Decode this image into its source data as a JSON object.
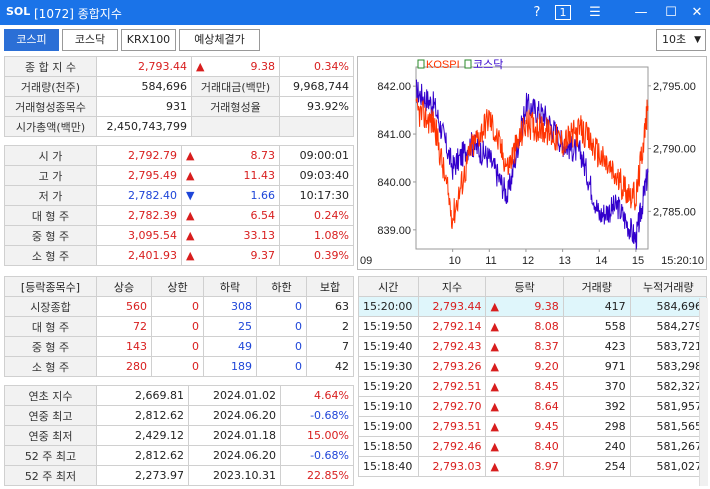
{
  "window": {
    "logo": "SOL",
    "title": "[1072] 종합지수",
    "help": "?",
    "page_num": "1",
    "menu": "☰",
    "minimize": "—",
    "maximize": "☐",
    "close": "✕"
  },
  "tabs": [
    "코스피",
    "코스닥",
    "KRX100",
    "예상체결가"
  ],
  "period": "10초",
  "summary": {
    "index_label": "종 합 지 수",
    "index_value": "2,793.44",
    "index_change": "9.38",
    "index_rate": "0.34%",
    "vol_label": "거래량(천주)",
    "vol_value": "584,696",
    "amt_label": "거래대금(백만)",
    "amt_value": "9,968,744",
    "form_label": "거래형성종목수",
    "form_value": "931",
    "form_rate_label": "거래형성율",
    "form_rate_value": "93.92%",
    "cap_label": "시가총액(백만)",
    "cap_value": "2,450,743,799"
  },
  "prices": [
    {
      "label": "시 가",
      "value": "2,792.79",
      "dir": "▲",
      "change": "8.73",
      "extra": "09:00:01",
      "color": "red"
    },
    {
      "label": "고 가",
      "value": "2,795.49",
      "dir": "▲",
      "change": "11.43",
      "extra": "09:03:40",
      "color": "red"
    },
    {
      "label": "저 가",
      "value": "2,782.40",
      "dir": "▼",
      "change": "1.66",
      "extra": "10:17:30",
      "color": "blue"
    },
    {
      "label": "대 형 주",
      "value": "2,782.39",
      "dir": "▲",
      "change": "6.54",
      "extra": "0.24%",
      "color": "red"
    },
    {
      "label": "중 형 주",
      "value": "3,095.54",
      "dir": "▲",
      "change": "33.13",
      "extra": "1.08%",
      "color": "red"
    },
    {
      "label": "소 형 주",
      "value": "2,401.93",
      "dir": "▲",
      "change": "9.37",
      "extra": "0.39%",
      "color": "red"
    }
  ],
  "breadth": {
    "headers": [
      "[등락종목수]",
      "상승",
      "상한",
      "하락",
      "하한",
      "보합"
    ],
    "rows": [
      {
        "label": "시장종합",
        "up": "560",
        "uplimit": "0",
        "down": "308",
        "downlimit": "0",
        "flat": "63"
      },
      {
        "label": "대 형 주",
        "up": "72",
        "uplimit": "0",
        "down": "25",
        "downlimit": "0",
        "flat": "2"
      },
      {
        "label": "중 형 주",
        "up": "143",
        "uplimit": "0",
        "down": "49",
        "downlimit": "0",
        "flat": "7"
      },
      {
        "label": "소 형 주",
        "up": "280",
        "uplimit": "0",
        "down": "189",
        "downlimit": "0",
        "flat": "42"
      }
    ]
  },
  "yearly": [
    {
      "label": "연초  지수",
      "value": "2,669.81",
      "date": "2024.01.02",
      "rate": "4.64%",
      "color": "red"
    },
    {
      "label": "연중  최고",
      "value": "2,812.62",
      "date": "2024.06.20",
      "rate": "-0.68%",
      "color": "blue"
    },
    {
      "label": "연중  최저",
      "value": "2,429.12",
      "date": "2024.01.18",
      "rate": "15.00%",
      "color": "red"
    },
    {
      "label": "52 주 최고",
      "value": "2,812.62",
      "date": "2024.06.20",
      "rate": "-0.68%",
      "color": "blue"
    },
    {
      "label": "52 주 최저",
      "value": "2,273.97",
      "date": "2023.10.31",
      "rate": "22.85%",
      "color": "red"
    }
  ],
  "ticks": {
    "headers": [
      "시간",
      "지수",
      "등락",
      "거래량",
      "누적거래량"
    ],
    "rows": [
      {
        "time": "15:20:00",
        "index": "2,793.44",
        "change": "9.38",
        "vol": "417",
        "cum": "584,696"
      },
      {
        "time": "15:19:50",
        "index": "2,792.14",
        "change": "8.08",
        "vol": "558",
        "cum": "584,279"
      },
      {
        "time": "15:19:40",
        "index": "2,792.43",
        "change": "8.37",
        "vol": "423",
        "cum": "583,721"
      },
      {
        "time": "15:19:30",
        "index": "2,793.26",
        "change": "9.20",
        "vol": "971",
        "cum": "583,298"
      },
      {
        "time": "15:19:20",
        "index": "2,792.51",
        "change": "8.45",
        "vol": "370",
        "cum": "582,327"
      },
      {
        "time": "15:19:10",
        "index": "2,792.70",
        "change": "8.64",
        "vol": "392",
        "cum": "581,957"
      },
      {
        "time": "15:19:00",
        "index": "2,793.51",
        "change": "9.45",
        "vol": "298",
        "cum": "581,565"
      },
      {
        "time": "15:18:50",
        "index": "2,792.46",
        "change": "8.40",
        "vol": "240",
        "cum": "581,267"
      },
      {
        "time": "15:18:40",
        "index": "2,793.03",
        "change": "8.97",
        "vol": "254",
        "cum": "581,027"
      }
    ]
  },
  "chart_data": {
    "type": "line",
    "legend": [
      "KOSPI",
      "코스닥"
    ],
    "colors": {
      "kospi": "#ff3300",
      "kosdaq": "#3300cc"
    },
    "left_ticks": [
      "842.00",
      "841.00",
      "840.00",
      "839.00"
    ],
    "right_ticks": [
      "2,795.00",
      "2,790.00",
      "2,785.00"
    ],
    "x_ticks": [
      "09",
      "10",
      "11",
      "12",
      "13",
      "14",
      "15"
    ],
    "x_end_label": "15:20:10",
    "kospi": {
      "x": [
        9.0,
        9.5,
        10.0,
        10.5,
        11.0,
        11.5,
        12.0,
        12.5,
        13.0,
        13.5,
        14.0,
        14.5,
        15.0,
        15.33
      ],
      "y": [
        2793.0,
        2792.0,
        2784.5,
        2790.0,
        2792.5,
        2788.5,
        2792.0,
        2791.5,
        2790.5,
        2791.5,
        2789.5,
        2787.5,
        2786.0,
        2793.4
      ]
    },
    "kosdaq": {
      "x": [
        9.0,
        9.5,
        10.0,
        10.5,
        11.0,
        11.5,
        12.0,
        12.5,
        13.0,
        13.5,
        14.0,
        14.5,
        15.0,
        15.33
      ],
      "y": [
        841.9,
        841.6,
        840.3,
        840.8,
        840.5,
        839.7,
        841.6,
        841.4,
        840.8,
        840.6,
        839.3,
        839.5,
        838.8,
        840.2
      ]
    },
    "ylim_left": [
      838.6,
      842.4
    ],
    "ylim_right": [
      2782.0,
      2796.5
    ],
    "xlim": [
      9.0,
      15.33
    ]
  }
}
